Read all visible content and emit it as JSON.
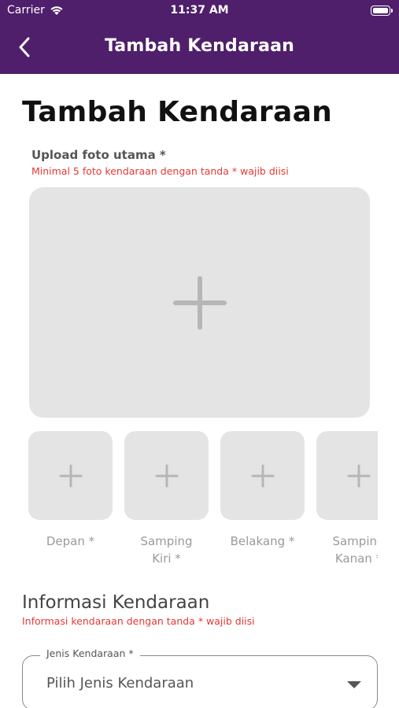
{
  "status_bar": {
    "carrier": "Carrier",
    "time": "11:37 AM"
  },
  "nav": {
    "title": "Tambah Kendaraan"
  },
  "page": {
    "title": "Tambah Kendaraan",
    "upload_label": "Upload foto utama *",
    "upload_note": "Minimal 5 foto kendaraan dengan tanda * wajib diisi"
  },
  "thumbnails": [
    {
      "label": "Depan *"
    },
    {
      "label": "Samping\nKiri *"
    },
    {
      "label": "Belakang *"
    },
    {
      "label": "Samping\nKanan *"
    }
  ],
  "info": {
    "title": "Informasi Kendaraan",
    "note": "Informasi kendaraan dengan tanda * wajib diisi"
  },
  "vehicle_type": {
    "label": "Jenis Kendaraan *",
    "value": "Pilih Jenis Kendaraan"
  },
  "colors": {
    "primary": "#4f1f6b",
    "required": "#e53935",
    "tile": "#e4e4e4"
  }
}
